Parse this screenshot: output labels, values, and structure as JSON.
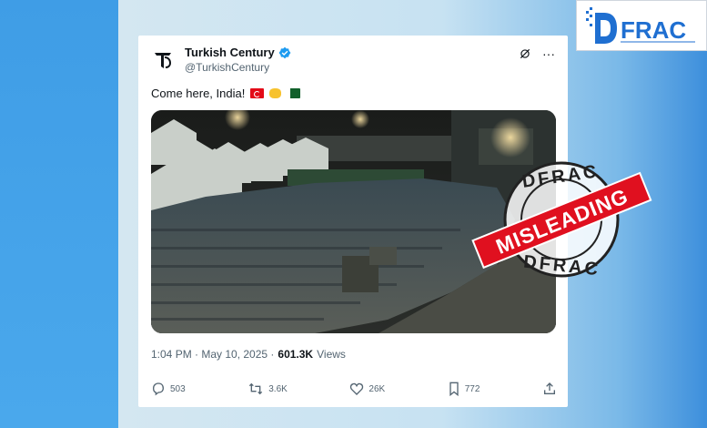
{
  "logo": {
    "text": "FRAC",
    "prefix_letter": "D"
  },
  "tweet": {
    "author_name": "Turkish Century",
    "verified": true,
    "handle": "@TurkishCentury",
    "avatar_text": "TC",
    "text": "Come here, India!",
    "emojis": [
      "flag-turkey-icon",
      "handshake-icon",
      "flag-pakistan-icon"
    ],
    "timestamp": "1:04 PM · May 10, 2025 ·",
    "views_count": "601.3K",
    "views_label": "Views",
    "stats": {
      "replies": "503",
      "reposts": "3.6K",
      "likes": "26K",
      "bookmarks": "772"
    }
  },
  "stamp": {
    "ring_text_top": "DFRAC",
    "ring_text_bottom": "DFRAC",
    "banner_text": "MISLEADING"
  },
  "colors": {
    "accent_blue": "#1d9bf0",
    "stamp_red": "#e0101f",
    "logo_blue": "#1f6fd1"
  }
}
